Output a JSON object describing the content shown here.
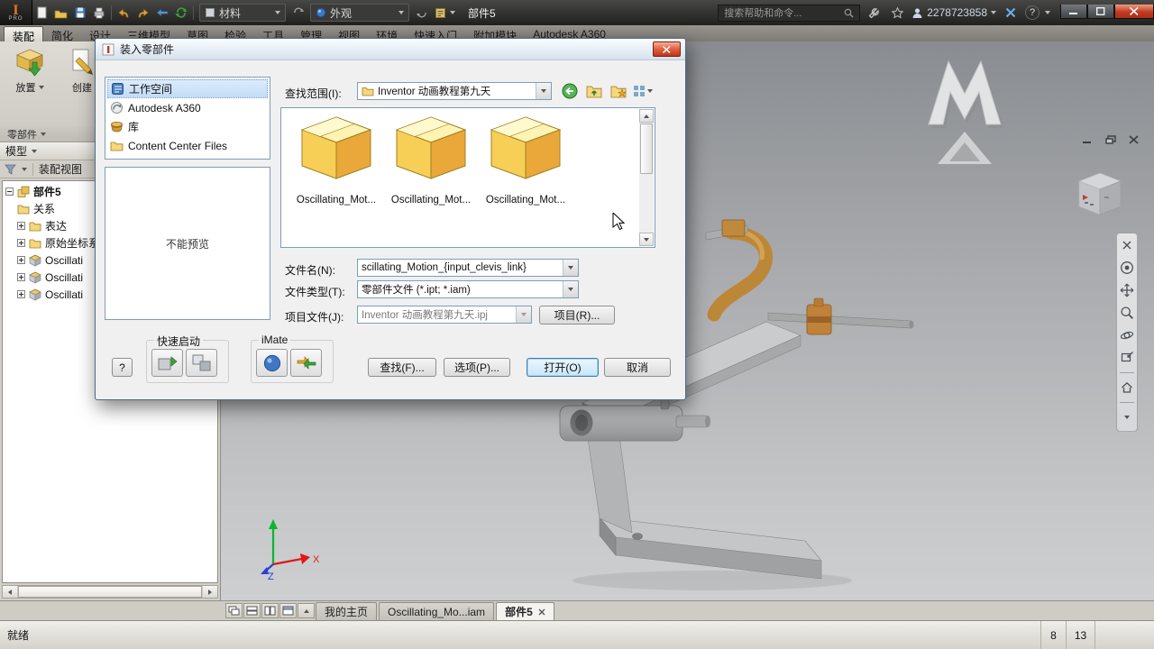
{
  "titlebar": {
    "doc_title": "部件5",
    "material": "材料",
    "appearance": "外观",
    "search": "搜索帮助和命令...",
    "username": "2278723858",
    "help_glyph": "?"
  },
  "ribbon": {
    "tabs": [
      "装配",
      "简化",
      "设计",
      "三维模型",
      "草图",
      "检验",
      "工具",
      "管理",
      "视图",
      "环境",
      "快速入门",
      "附加模块",
      "Autodesk A360"
    ],
    "place": "放置",
    "create": "创建",
    "panel": "零部件"
  },
  "browser": {
    "header": "模型",
    "filter": "装配视图",
    "tree": [
      {
        "label": "部件5"
      },
      {
        "label": "关系"
      },
      {
        "label": "表达"
      },
      {
        "label": "原始坐标系"
      },
      {
        "label": "Oscillati"
      },
      {
        "label": "Oscillati"
      },
      {
        "label": "Oscillati"
      }
    ]
  },
  "dialog": {
    "title": "装入零部件",
    "locations": [
      {
        "label": "工作空间"
      },
      {
        "label": "Autodesk A360"
      },
      {
        "label": "库"
      },
      {
        "label": "Content Center Files"
      }
    ],
    "preview": "不能预览",
    "look_in_label": "查找范围(I):",
    "look_in_value": "Inventor 动画教程第九天",
    "files": [
      {
        "name": "Oscillating_Mot..."
      },
      {
        "name": "Oscillating_Mot..."
      },
      {
        "name": "Oscillating_Mot..."
      }
    ],
    "filename_label": "文件名(N):",
    "filename_value": "scillating_Motion_{input_clevis_link}",
    "filetype_label": "文件类型(T):",
    "filetype_value": "零部件文件 (*.ipt; *.iam)",
    "project_label": "项目文件(J):",
    "project_value": "Inventor 动画教程第九天.ipj",
    "project_btn": "项目(R)...",
    "quick_launch": "快速启动",
    "imate": "iMate",
    "help": "?",
    "find_btn": "查找(F)...",
    "options_btn": "选项(P)...",
    "open_btn": "打开(O)",
    "cancel_btn": "取消"
  },
  "viewport": {
    "axis_x": "X",
    "axis_z": "Z"
  },
  "doc_tabs": [
    {
      "label": "我的主页"
    },
    {
      "label": "Oscillating_Mo...iam"
    },
    {
      "label": "部件5"
    }
  ],
  "statusbar": {
    "ready": "就绪",
    "n1": "8",
    "n2": "13"
  },
  "colors": {
    "accent_blue": "#3c7fb1",
    "cube_yellow": "#f8cf56",
    "link_orange": "#c08a3c",
    "close_red": "#c03417",
    "axis_x_red": "#e01818",
    "axis_y_green": "#0bb52c",
    "axis_z_blue": "#2b3fd6"
  }
}
